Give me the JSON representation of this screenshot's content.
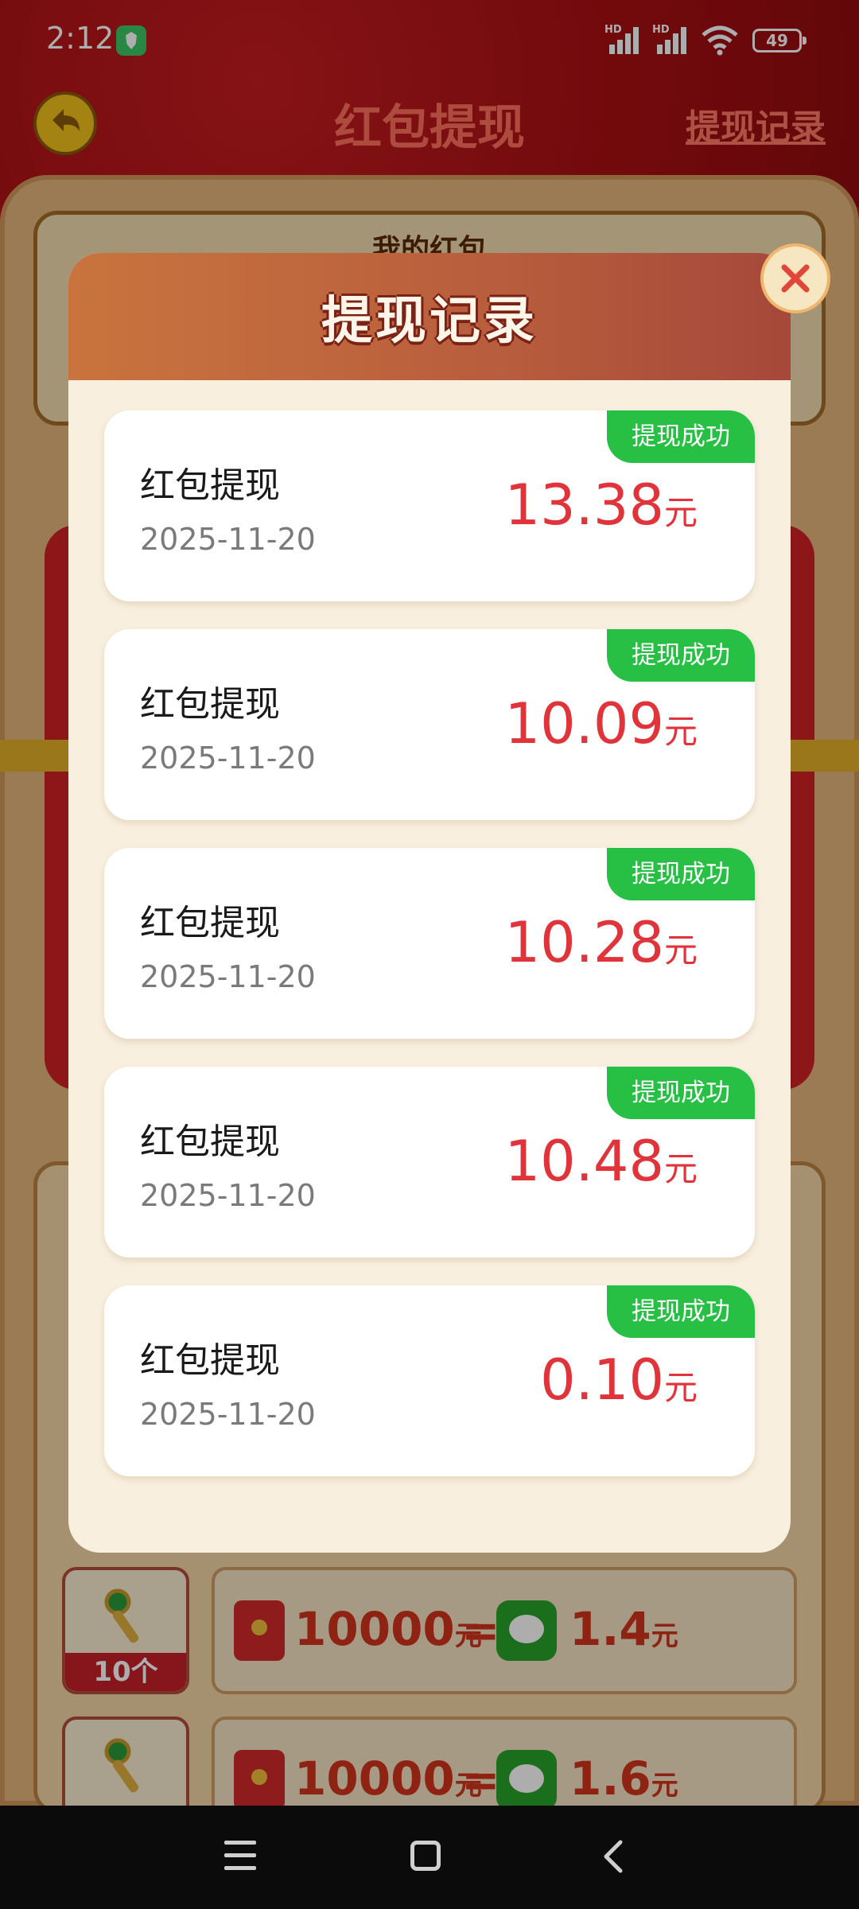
{
  "status_bar": {
    "time": "2:12",
    "battery": "49",
    "signal_labels": [
      "HD",
      "HD"
    ]
  },
  "page": {
    "title": "红包提现",
    "history_link": "提现记录",
    "my_redpacket_label": "我的红包",
    "accent_color": "#b8141a"
  },
  "exchange_rows": [
    {
      "key_count": "10个",
      "redpacket_amount": "10000",
      "redpacket_unit": "元",
      "equals": "=",
      "wechat_amount": "1.4",
      "wechat_unit": "元"
    },
    {
      "key_count": "",
      "redpacket_amount": "10000",
      "redpacket_unit": "元",
      "equals": "=",
      "wechat_amount": "1.6",
      "wechat_unit": "元"
    }
  ],
  "modal": {
    "title": "提现记录",
    "close_icon": "close-icon",
    "records": [
      {
        "name": "红包提现",
        "date": "2025-11-20",
        "amount": "13.38",
        "unit": "元",
        "status": "提现成功"
      },
      {
        "name": "红包提现",
        "date": "2025-11-20",
        "amount": "10.09",
        "unit": "元",
        "status": "提现成功"
      },
      {
        "name": "红包提现",
        "date": "2025-11-20",
        "amount": "10.28",
        "unit": "元",
        "status": "提现成功"
      },
      {
        "name": "红包提现",
        "date": "2025-11-20",
        "amount": "10.48",
        "unit": "元",
        "status": "提现成功"
      },
      {
        "name": "红包提现",
        "date": "2025-11-20",
        "amount": "0.10",
        "unit": "元",
        "status": "提现成功"
      }
    ],
    "success_color": "#27c045",
    "amount_color": "#e0333a"
  },
  "nav": {
    "icons": [
      "menu-icon",
      "home-icon",
      "back-icon"
    ]
  }
}
